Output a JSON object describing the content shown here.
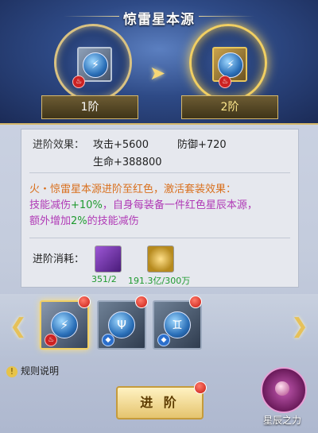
{
  "title": "惊雷星本源",
  "stages": {
    "current": "1阶",
    "next": "2阶"
  },
  "effects": {
    "label": "进阶效果：",
    "attack": "攻击+5600",
    "defense": "防御+720",
    "hp": "生命+388800"
  },
  "set_bonus": {
    "line1": "火・惊雷星本源进阶至红色，激活套装效果：",
    "line2_a": "技能减伤",
    "line2_b": "+10%",
    "line2_c": "，自身每装备一件红色星辰本源，",
    "line3_a": "额外增加",
    "line3_b": "2%",
    "line3_c": "的技能减伤"
  },
  "cost": {
    "label": "进阶消耗：",
    "items": [
      {
        "icon": "purple-crystal-icon",
        "amount": "351/2"
      },
      {
        "icon": "gold-coins-icon",
        "amount": "191.3亿/300万"
      }
    ]
  },
  "carousel": {
    "items": [
      {
        "icon": "lightning-icon",
        "element": "fire",
        "selected": true
      },
      {
        "icon": "trident-icon",
        "element": "water",
        "selected": false
      },
      {
        "icon": "gemini-icon",
        "element": "water",
        "selected": false
      }
    ]
  },
  "rules_label": "规则说明",
  "advance_button": "进 阶",
  "star_power_label": "星辰之力",
  "colors": {
    "set_title": "#d9701e",
    "highlight": "#b03ab6",
    "value": "#1f9a2f",
    "accent_gold": "#f1cf62"
  }
}
